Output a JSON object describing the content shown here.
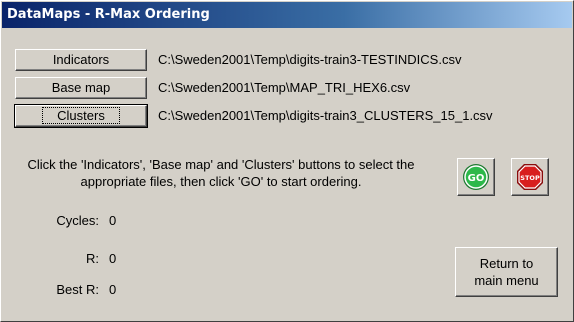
{
  "window": {
    "title": "DataMaps - R-Max Ordering"
  },
  "files": [
    {
      "button_label": "Indicators",
      "path": "C:\\Sweden2001\\Temp\\digits-train3-TESTINDICS.csv"
    },
    {
      "button_label": "Base map",
      "path": "C:\\Sweden2001\\Temp\\MAP_TRI_HEX6.csv"
    },
    {
      "button_label": "Clusters",
      "path": "C:\\Sweden2001\\Temp\\digits-train3_CLUSTERS_15_1.csv"
    }
  ],
  "instructions": "Click the 'Indicators', 'Base map' and 'Clusters' buttons to select the appropriate files, then click 'GO' to start ordering.",
  "stats": {
    "cycles_label": "Cycles:",
    "cycles_value": "0",
    "r_label": "R:",
    "r_value": "0",
    "best_r_label": "Best R:",
    "best_r_value": "0"
  },
  "buttons": {
    "go_label": "GO",
    "stop_label": "STOP",
    "return_label": "Return to\nmain menu"
  },
  "colors": {
    "go_green": "#2db84a",
    "stop_red": "#d81e1e"
  }
}
